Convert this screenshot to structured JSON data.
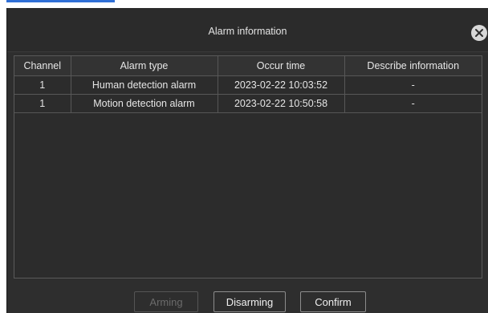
{
  "dialog": {
    "title": "Alarm information"
  },
  "table": {
    "columns": [
      "Channel",
      "Alarm type",
      "Occur time",
      "Describe information"
    ],
    "rows": [
      [
        "1",
        "Human detection alarm",
        "2023-02-22 10:03:52",
        "-"
      ],
      [
        "1",
        "Motion detection alarm",
        "2023-02-22 10:50:58",
        "-"
      ]
    ]
  },
  "footer": {
    "arming_label": "Arming",
    "disarming_label": "Disarming",
    "confirm_label": "Confirm"
  },
  "colors": {
    "dialog_bg": "#2e2e2e",
    "accent": "#2f6fd6",
    "close_button": "#d8d8d8"
  },
  "icons": {
    "close": "close-icon"
  }
}
